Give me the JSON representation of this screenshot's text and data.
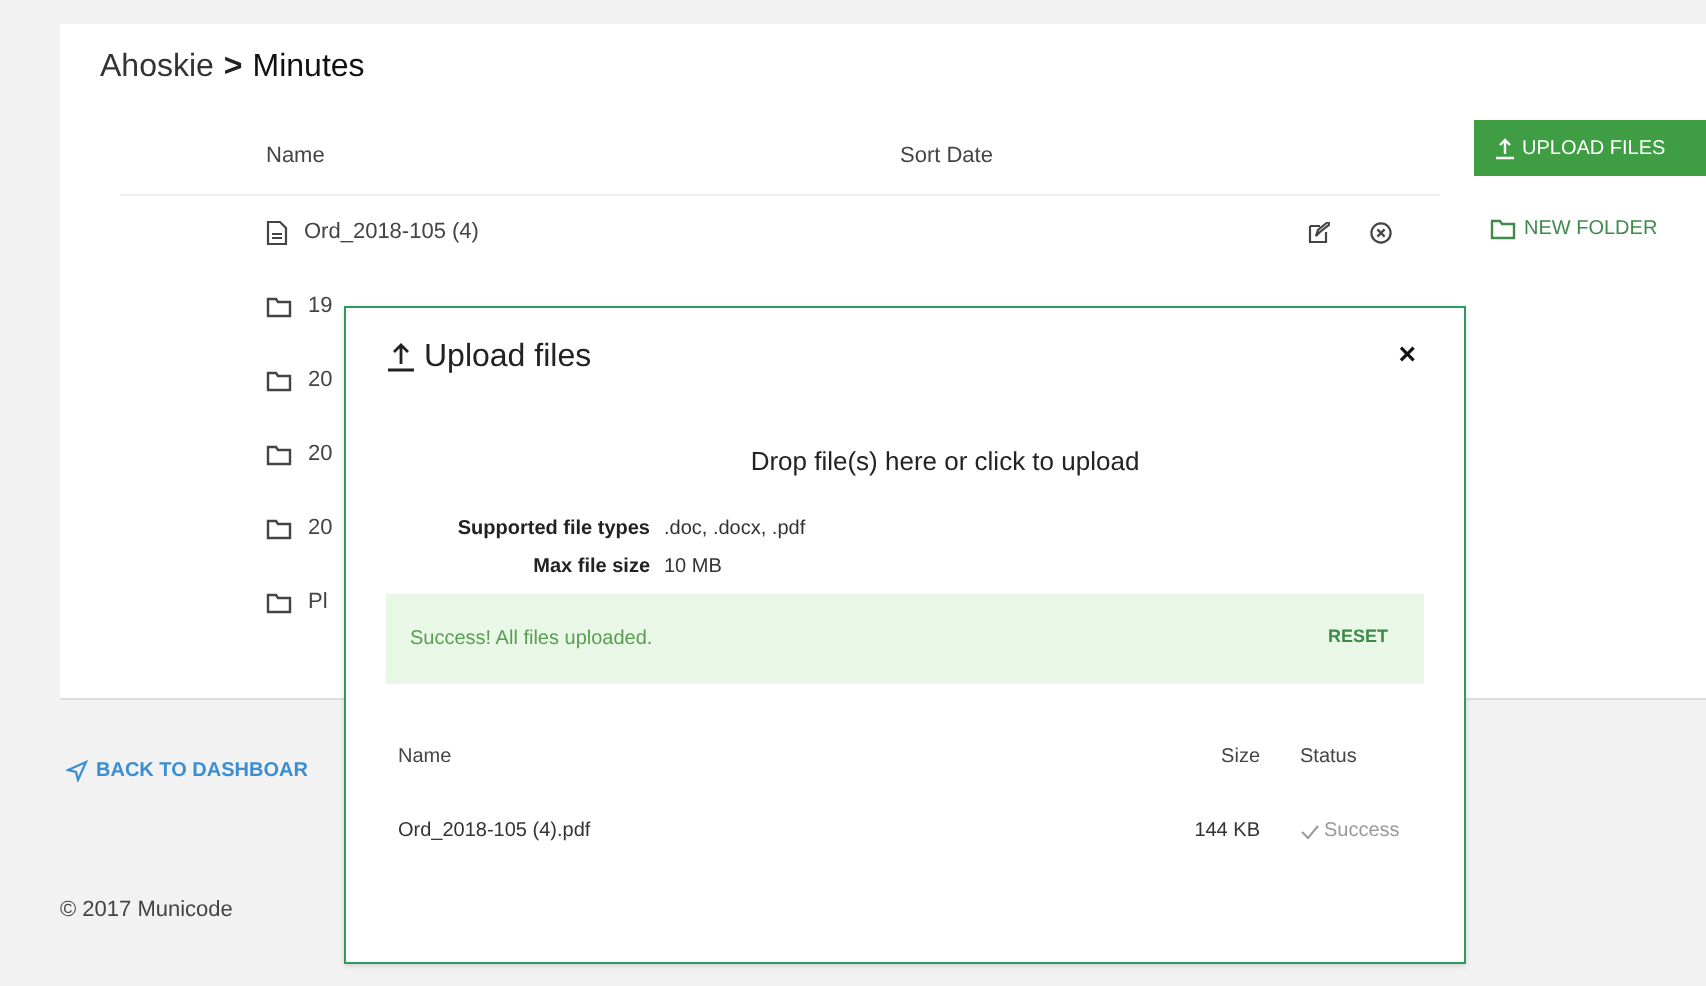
{
  "breadcrumb": {
    "parent": "Ahoskie",
    "separator": ">",
    "current": "Minutes"
  },
  "columns": [
    "Name",
    "Sort Date"
  ],
  "rows": [
    {
      "kind": "file",
      "name": "Ord_2018-105 (4)"
    },
    {
      "kind": "folder",
      "name": "19"
    },
    {
      "kind": "folder",
      "name": "20"
    },
    {
      "kind": "folder",
      "name": "20"
    },
    {
      "kind": "folder",
      "name": "20"
    },
    {
      "kind": "folder",
      "name": "Pl"
    }
  ],
  "upload_button": "UPLOAD FILES",
  "new_folder": "NEW FOLDER",
  "back_link": "BACK TO DASHBOAR",
  "footer": "© 2017 Municode",
  "modal": {
    "title": "Upload files",
    "close": "×",
    "dropzone": "Drop file(s) here or click to upload",
    "info": [
      {
        "label": "Supported file types",
        "value": ".doc, .docx, .pdf"
      },
      {
        "label": "Max file size",
        "value": "10 MB"
      }
    ],
    "alert": {
      "message": "Success! All files uploaded.",
      "action": "RESET"
    },
    "columns": [
      "Name",
      "Size",
      "Status"
    ],
    "files": [
      {
        "name": "Ord_2018-105 (4).pdf",
        "size": "144 KB",
        "status": "Success"
      }
    ]
  }
}
